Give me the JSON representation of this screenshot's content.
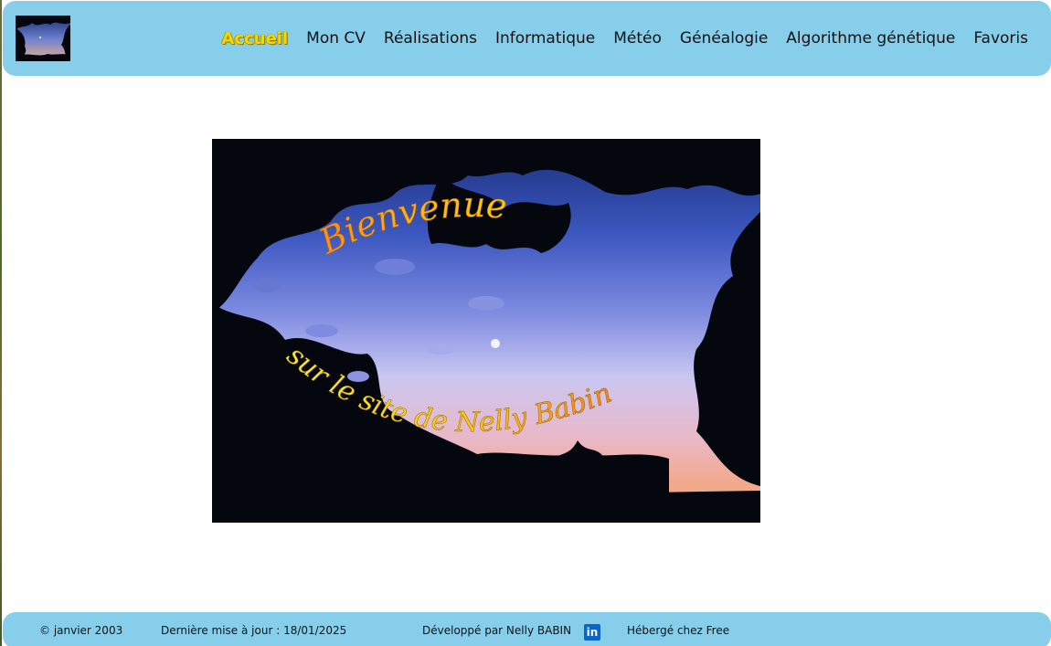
{
  "header": {
    "logo_icon": "evening-tree-silhouette-logo",
    "nav": [
      {
        "label": "Accueil",
        "active": true
      },
      {
        "label": "Mon CV",
        "active": false
      },
      {
        "label": "Réalisations",
        "active": false
      },
      {
        "label": "Informatique",
        "active": false
      },
      {
        "label": "Météo",
        "active": false
      },
      {
        "label": "Généalogie",
        "active": false
      },
      {
        "label": "Algorithme génétique",
        "active": false
      },
      {
        "label": "Favoris",
        "active": false
      }
    ]
  },
  "banner": {
    "line1": "Bienvenue",
    "line2": "sur le site de Nelly Babin"
  },
  "footer": {
    "copyright": "© janvier 2003",
    "last_update": "Dernière mise à jour : 18/01/2025",
    "developed_by": "Développé par Nelly BABIN",
    "linkedin_icon": "linkedin-icon",
    "hosted": "Hébergé chez Free"
  },
  "colors": {
    "bar": "#87ceeb",
    "active_nav": "#f5d800"
  }
}
